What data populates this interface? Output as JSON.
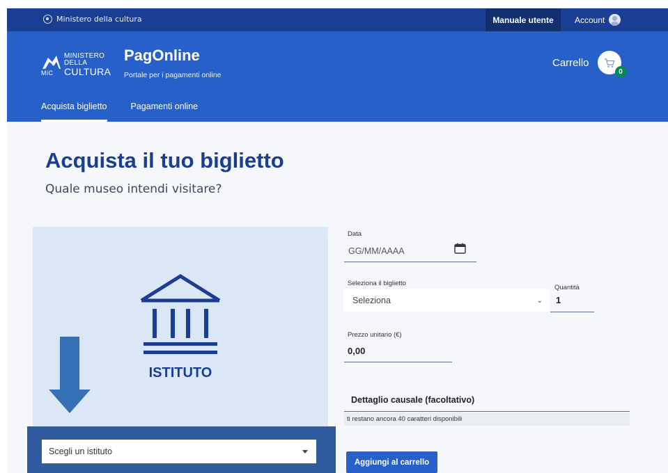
{
  "topbar": {
    "ministry": "Ministero della cultura",
    "manual_label": "Manuale utente",
    "account_label": "Account"
  },
  "header": {
    "logo": {
      "line1": "MINISTERO",
      "line2": "DELLA",
      "line3": "CULTURA",
      "mic": "MiC"
    },
    "title": "PagOnline",
    "subtitle": "Portale per i pagamenti online",
    "cart_label": "Carrello",
    "cart_count": "0"
  },
  "nav": {
    "tabs": [
      {
        "label": "Acquista biglietto",
        "active": true
      },
      {
        "label": "Pagamenti online",
        "active": false
      }
    ]
  },
  "main": {
    "title": "Acquista il tuo biglietto",
    "subtitle": "Quale museo intendi visitare?"
  },
  "card": {
    "label": "ISTITUTO",
    "select_value": "Scegli un istituto"
  },
  "form": {
    "date_label": "Data",
    "date_placeholder": "GG/MM/AAAA",
    "ticket_label": "Seleziona il biglietto",
    "ticket_value": "Seleziona",
    "qty_label": "Quantità",
    "qty_value": "1",
    "price_label": "Prezzo unitario (€)",
    "price_value": "0,00",
    "causale_label": "Dettaglio causale (facoltativo)",
    "causale_hint": "ti restano ancora 40 caratteri disponibili",
    "add_button": "Aggiungi al carrello"
  },
  "colors": {
    "topbar": "#1a3e91",
    "header": "#2760c9",
    "accent": "#1a3e91",
    "card": "#dbe7f6",
    "highlight": "#305b9e",
    "badge": "#008758"
  }
}
